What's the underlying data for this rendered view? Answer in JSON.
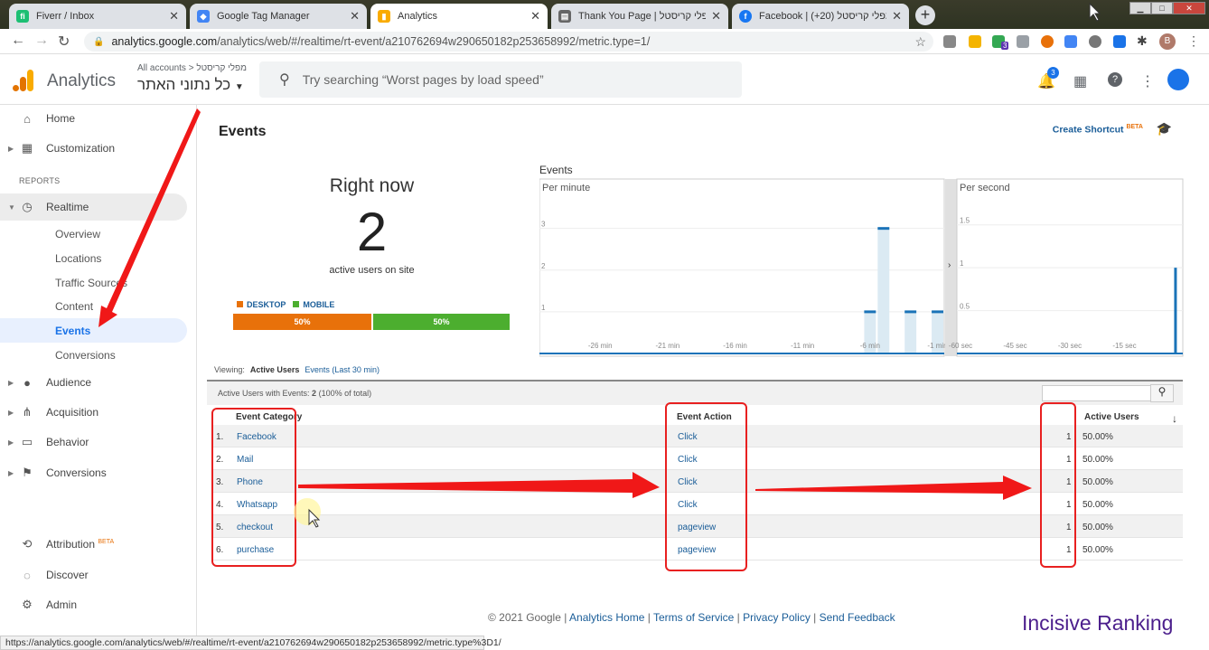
{
  "browser": {
    "tabs": [
      {
        "title": "Fiverr / Inbox",
        "color": "#1dbf73",
        "glyph": "fi"
      },
      {
        "title": "Google Tag Manager",
        "color": "#4285f4",
        "glyph": "◆"
      },
      {
        "title": "Analytics",
        "color": "#f9ab00",
        "glyph": "▮"
      },
      {
        "title": "Thank You Page | מפלי קריסטל",
        "color": "#666666",
        "glyph": "▤"
      },
      {
        "title": "Facebook | מפלי קריסטל (20+)",
        "color": "#1877f2",
        "glyph": "f"
      }
    ],
    "url_host": "analytics.google.com",
    "url_path": "/analytics/web/#/realtime/rt-event/a210762694w290650182p253658992/metric.type=1/",
    "profile_initial": "B",
    "extension_badge": "3"
  },
  "ga": {
    "product": "Analytics",
    "breadcrumb_all": "All accounts",
    "breadcrumb_account": "מפלי קריסטל",
    "property": "כל נתוני האתר",
    "search_placeholder": "Try searching “Worst pages by load speed”",
    "notif_count": "3"
  },
  "sidebar": {
    "home": "Home",
    "customization": "Customization",
    "reports_header": "REPORTS",
    "realtime": "Realtime",
    "realtime_sub": [
      "Overview",
      "Locations",
      "Traffic Sources",
      "Content",
      "Events",
      "Conversions"
    ],
    "audience": "Audience",
    "acquisition": "Acquisition",
    "behavior": "Behavior",
    "conversions": "Conversions",
    "attribution": "Attribution",
    "attribution_badge": "BETA",
    "discover": "Discover",
    "admin": "Admin"
  },
  "main": {
    "title": "Events",
    "shortcut": "Create Shortcut",
    "shortcut_badge": "BETA",
    "right_now": "Right now",
    "active_count": "2",
    "active_label": "active users on site",
    "legend_desktop": "DESKTOP",
    "legend_mobile": "MOBILE",
    "desktop_pct": "50%",
    "mobile_pct": "50%",
    "desktop_share": 0.5,
    "desktop_color": "#e8710a",
    "mobile_color": "#4cae2f",
    "viewing_label": "Viewing:",
    "viewing_active": "Active Users",
    "viewing_link": "Events (Last 30 min)"
  },
  "chart_data": [
    {
      "type": "bar",
      "title": "Events",
      "subtitle": "Per minute",
      "ylim": [
        0,
        3.6
      ],
      "y_ticks": [
        "1",
        "2",
        "3"
      ],
      "x_ticks": [
        "-26 min",
        "-21 min",
        "-16 min",
        "-11 min",
        "-6 min",
        "-1 min"
      ],
      "categories": [
        "-30",
        "-29",
        "-28",
        "-27",
        "-26",
        "-25",
        "-24",
        "-23",
        "-22",
        "-21",
        "-20",
        "-19",
        "-18",
        "-17",
        "-16",
        "-15",
        "-14",
        "-13",
        "-12",
        "-11",
        "-10",
        "-9",
        "-8",
        "-7",
        "-6",
        "-5",
        "-4",
        "-3",
        "-2",
        "-1"
      ],
      "values": [
        0,
        0,
        0,
        0,
        0,
        0,
        0,
        0,
        0,
        0,
        0,
        0,
        0,
        0,
        0,
        0,
        0,
        0,
        0,
        0,
        0,
        0,
        0,
        0,
        1,
        3,
        0,
        1,
        0,
        1
      ]
    },
    {
      "type": "bar",
      "subtitle": "Per second",
      "ylim": [
        0,
        1.75
      ],
      "y_ticks": [
        "0.5",
        "1",
        "1.5"
      ],
      "x_ticks": [
        "-60 sec",
        "-45 sec",
        "-30 sec",
        "-15 sec"
      ],
      "spike_at_sec": -1,
      "spike_value": 1
    }
  ],
  "table": {
    "summary_label": "Active Users with Events:",
    "summary_value": "2",
    "summary_pct": "(100% of total)",
    "col_category": "Event Category",
    "col_action": "Event Action",
    "col_users": "Active Users",
    "rows": [
      {
        "n": "1.",
        "cat": "Facebook",
        "act": "Click",
        "users": "1",
        "pct": "50.00%"
      },
      {
        "n": "2.",
        "cat": "Mail",
        "act": "Click",
        "users": "1",
        "pct": "50.00%"
      },
      {
        "n": "3.",
        "cat": "Phone",
        "act": "Click",
        "users": "1",
        "pct": "50.00%"
      },
      {
        "n": "4.",
        "cat": "Whatsapp",
        "act": "Click",
        "users": "1",
        "pct": "50.00%"
      },
      {
        "n": "5.",
        "cat": "checkout",
        "act": "pageview",
        "users": "1",
        "pct": "50.00%"
      },
      {
        "n": "6.",
        "cat": "purchase",
        "act": "pageview",
        "users": "1",
        "pct": "50.00%"
      }
    ]
  },
  "footer": {
    "copyright": "© 2021 Google |",
    "links": [
      "Analytics Home",
      "Terms of Service",
      "Privacy Policy",
      "Send Feedback"
    ]
  },
  "watermark": "Incisive Ranking",
  "status_url": "https://analytics.google.com/analytics/web/#/realtime/rt-event/a210762694w290650182p253658992/metric.type%3D1/"
}
